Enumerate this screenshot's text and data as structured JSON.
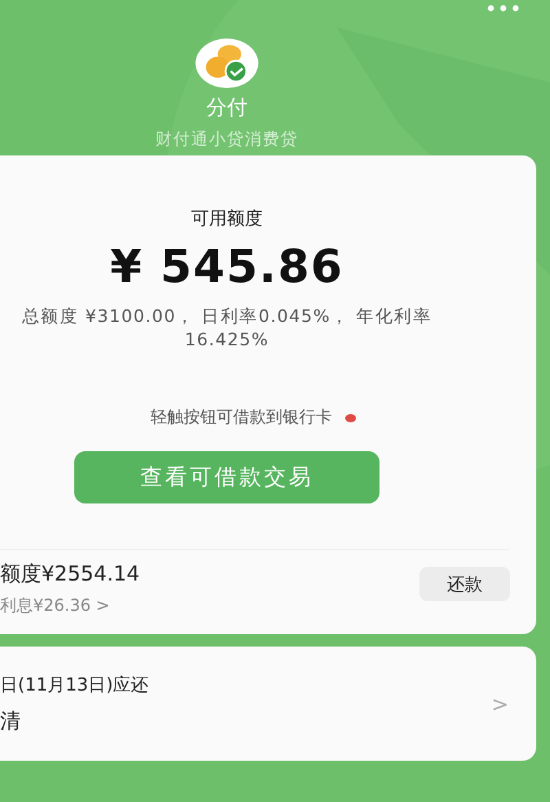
{
  "header": {
    "title": "分付",
    "subtitle": "财付通小贷消费贷"
  },
  "credit_card": {
    "label": "可用额度",
    "amount": "¥ 545.86",
    "details": "总额度 ¥3100.00， 日利率0.045%， 年化利率 16.425%",
    "hint": "轻触按钮可借款到银行卡",
    "button": "查看可借款交易"
  },
  "bill_row": {
    "amount": "额度¥2554.14",
    "interest": "利息¥26.36 >",
    "button": "还款"
  },
  "due_card": {
    "date": "日(11月13日)应还",
    "status": "清",
    "chevron": ">"
  }
}
